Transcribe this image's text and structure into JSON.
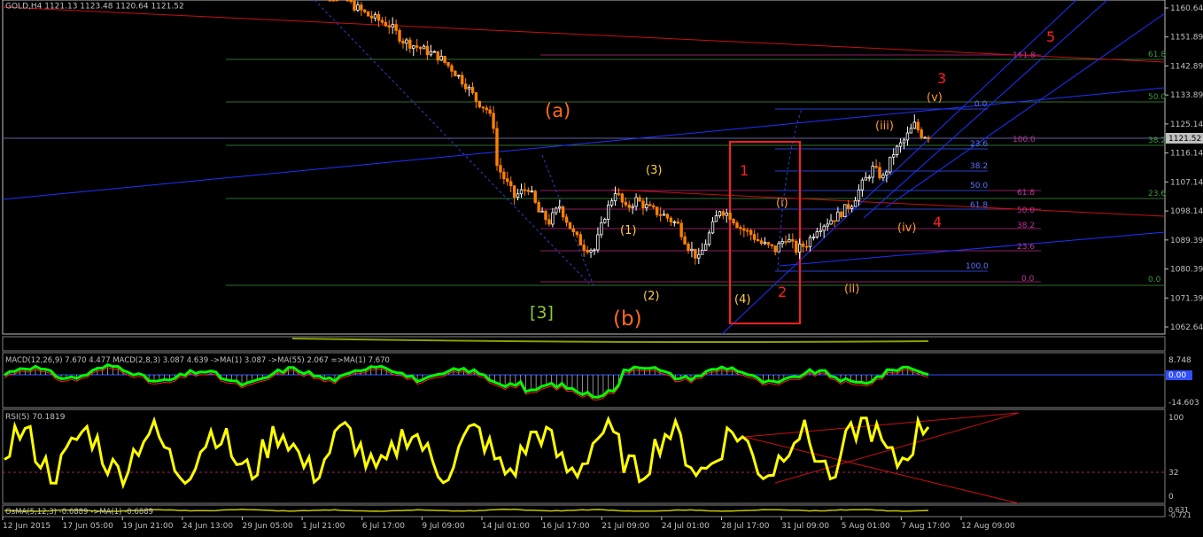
{
  "window": {
    "title": "GOLD,H4  1121.13 1123.48 1120.64 1121.52"
  },
  "colors": {
    "background": "#000000",
    "axis": "#c0c0c0",
    "text": "#c0c0c0",
    "bull": "#ffffff",
    "bear": "#ff8000",
    "fib_green": "#3a7a3a",
    "fib_blue": "#3050ff",
    "fib_magenta": "#a0206a",
    "trend_red": "#d01010",
    "trend_blue": "#2030ff",
    "wave_orange": "#ff8c1a",
    "wave_yellow": "#ffd040",
    "wave_green": "#8cc83c",
    "box_red": "#ff2020",
    "macd_green": "#00ff00",
    "macd_red": "#ff2020",
    "rsi": "#ffff00",
    "osma": "#c8c800"
  },
  "price_axis": {
    "ticks": [
      "1160.64",
      "1151.89",
      "1142.89",
      "1133.89",
      "1125.14",
      "1116.14",
      "1107.14",
      "1098.14",
      "1089.39",
      "1080.39",
      "1071.39",
      "1062.64"
    ],
    "current_price": "1121.52"
  },
  "time_axis": {
    "labels": [
      "12 Jun 2015",
      "17 Jun 05:00",
      "19 Jun 21:00",
      "24 Jun 13:00",
      "29 Jun 05:00",
      "1 Jul 21:00",
      "6 Jul 17:00",
      "9 Jul 09:00",
      "14 Jul 01:00",
      "16 Jul 17:00",
      "21 Jul 09:00",
      "24 Jul 01:00",
      "28 Jul 17:00",
      "31 Jul 09:00",
      "5 Aug 01:00",
      "7 Aug 17:00",
      "12 Aug 09:00"
    ]
  },
  "wave_labels": {
    "a": "(a)",
    "b": "(b)",
    "three_bracket": "[3]",
    "y1": "(1)",
    "y2": "(2)",
    "y3": "(3)",
    "y4": "(4)",
    "r1": "1",
    "r2": "2",
    "r3": "3",
    "r4": "4",
    "r5": "5",
    "oi": "(i)",
    "oii": "(ii)",
    "oiii": "(iii)",
    "oiv": "(iv)",
    "ov": "(v)"
  },
  "fib_labels": {
    "g618": "61.8",
    "g500": "50.0",
    "g382": "38.2",
    "g236": "23.6",
    "g00": "0.0",
    "m1618": "161.8",
    "m1000": "100.0",
    "m618": "61.8",
    "m500": "50.0",
    "m382": "38.2",
    "m236": "23.6",
    "m00": "0.0",
    "b00": "0.0",
    "b236": "23.6",
    "b382": "38.2",
    "b500": "50.0",
    "b618": "61.8",
    "b1000": "100.0"
  },
  "indicators": {
    "macd_label": "MACD(12,26,9) 7.670 4.477  MACD(2,8,3) 3.087 4.639  ->MA(1) 3.087  ->MA(55) 2.067  =>MA(1) 7.670",
    "macd_ticks": [
      "8.748",
      "0.00",
      "-14.603"
    ],
    "macd_current": "7.670",
    "rsi_label": "RSI(5) 70.1819",
    "rsi_ticks": [
      "100",
      "32",
      "0"
    ],
    "osma_label": "OsMA(5,12,3) -0.6889  ->MA(1) -0.6889",
    "osma_ticks": [
      "0.631",
      "-0.721"
    ]
  },
  "chart_data": {
    "type": "candlestick",
    "symbol": "GOLD",
    "timeframe": "H4",
    "ohlc_header": {
      "open": 1121.13,
      "high": 1123.48,
      "low": 1120.64,
      "close": 1121.52
    },
    "ylim": [
      1058,
      1165
    ],
    "close_path": [
      [
        0,
        1170
      ],
      [
        8,
        1168
      ],
      [
        14,
        1163
      ],
      [
        18,
        1160
      ],
      [
        24,
        1157
      ],
      [
        28,
        1152
      ],
      [
        32,
        1150
      ],
      [
        38,
        1147
      ],
      [
        42,
        1143
      ],
      [
        46,
        1138
      ],
      [
        49,
        1133
      ],
      [
        52,
        1130
      ],
      [
        54,
        1125
      ],
      [
        55,
        1112
      ],
      [
        57,
        1108
      ],
      [
        60,
        1102
      ],
      [
        64,
        1105
      ],
      [
        67,
        1097
      ],
      [
        70,
        1094
      ],
      [
        73,
        1099
      ],
      [
        77,
        1090
      ],
      [
        80,
        1086
      ],
      [
        83,
        1085
      ],
      [
        86,
        1096
      ],
      [
        89,
        1104
      ],
      [
        92,
        1098
      ],
      [
        95,
        1101
      ],
      [
        99,
        1098
      ],
      [
        103,
        1096
      ],
      [
        107,
        1093
      ],
      [
        110,
        1086
      ],
      [
        113,
        1082
      ],
      [
        116,
        1090
      ],
      [
        119,
        1098
      ],
      [
        122,
        1096
      ],
      [
        125,
        1092
      ],
      [
        128,
        1090
      ],
      [
        131,
        1087
      ],
      [
        135,
        1085
      ],
      [
        138,
        1089
      ],
      [
        141,
        1085
      ],
      [
        144,
        1087
      ],
      [
        147,
        1092
      ],
      [
        150,
        1094
      ],
      [
        153,
        1096
      ],
      [
        157,
        1100
      ],
      [
        160,
        1106
      ],
      [
        163,
        1111
      ],
      [
        166,
        1108
      ],
      [
        169,
        1116
      ],
      [
        172,
        1120
      ],
      [
        175,
        1125
      ],
      [
        177,
        1122
      ],
      [
        179,
        1121.5
      ]
    ],
    "osc_bars": 180
  }
}
